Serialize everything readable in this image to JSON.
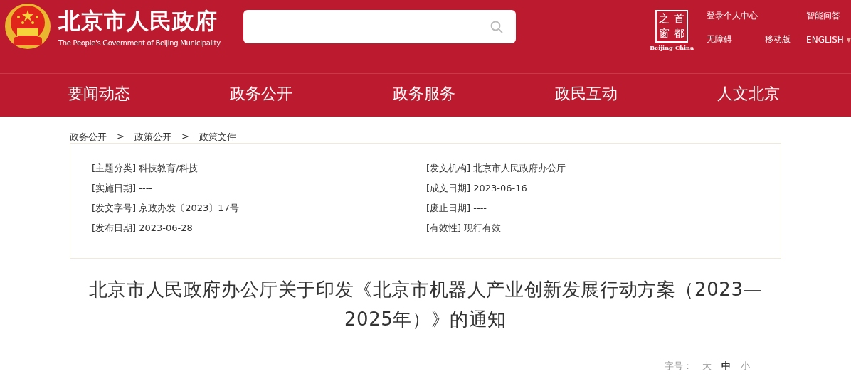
{
  "header": {
    "site_title": "北京市人民政府",
    "site_subtitle": "The People's Government of Beijing Municipality",
    "badge": {
      "chars": [
        "之",
        "首",
        "窗",
        "都"
      ],
      "caption": "Beijing-China"
    },
    "links": [
      {
        "label": "登录个人中心"
      },
      {
        "label": "智能问答"
      },
      {
        "label": "无障碍"
      },
      {
        "label": "移动版"
      }
    ],
    "language": {
      "label": "ENGLISH",
      "caret": "▼"
    }
  },
  "nav": [
    {
      "label": "要闻动态",
      "selected": false
    },
    {
      "label": "政务公开",
      "selected": false
    },
    {
      "label": "政务服务",
      "selected": false
    },
    {
      "label": "政民互动",
      "selected": false
    },
    {
      "label": "人文北京",
      "selected": false
    }
  ],
  "breadcrumb": [
    {
      "label": "政务公开"
    },
    {
      "label": "政策公开"
    },
    {
      "label": "政策文件"
    }
  ],
  "breadcrumb_separator": ">",
  "meta": [
    "[主题分类] 科技教育/科技",
    "[发文机构] 北京市人民政府办公厅",
    "[实施日期] ----",
    "[成文日期] 2023-06-16",
    "[发文字号] 京政办发〔2023〕17号",
    "[废止日期] ----",
    "[发布日期] 2023-06-28",
    "[有效性] 现行有效"
  ],
  "article_title": "北京市人民政府办公厅关于印发《北京市机器人产业创新发展行动方案（2023—2025年）》的通知",
  "font_size": {
    "label": "字号：",
    "options": [
      {
        "label": "大",
        "selected": false
      },
      {
        "label": "中",
        "selected": true
      },
      {
        "label": "小",
        "selected": false
      }
    ]
  }
}
